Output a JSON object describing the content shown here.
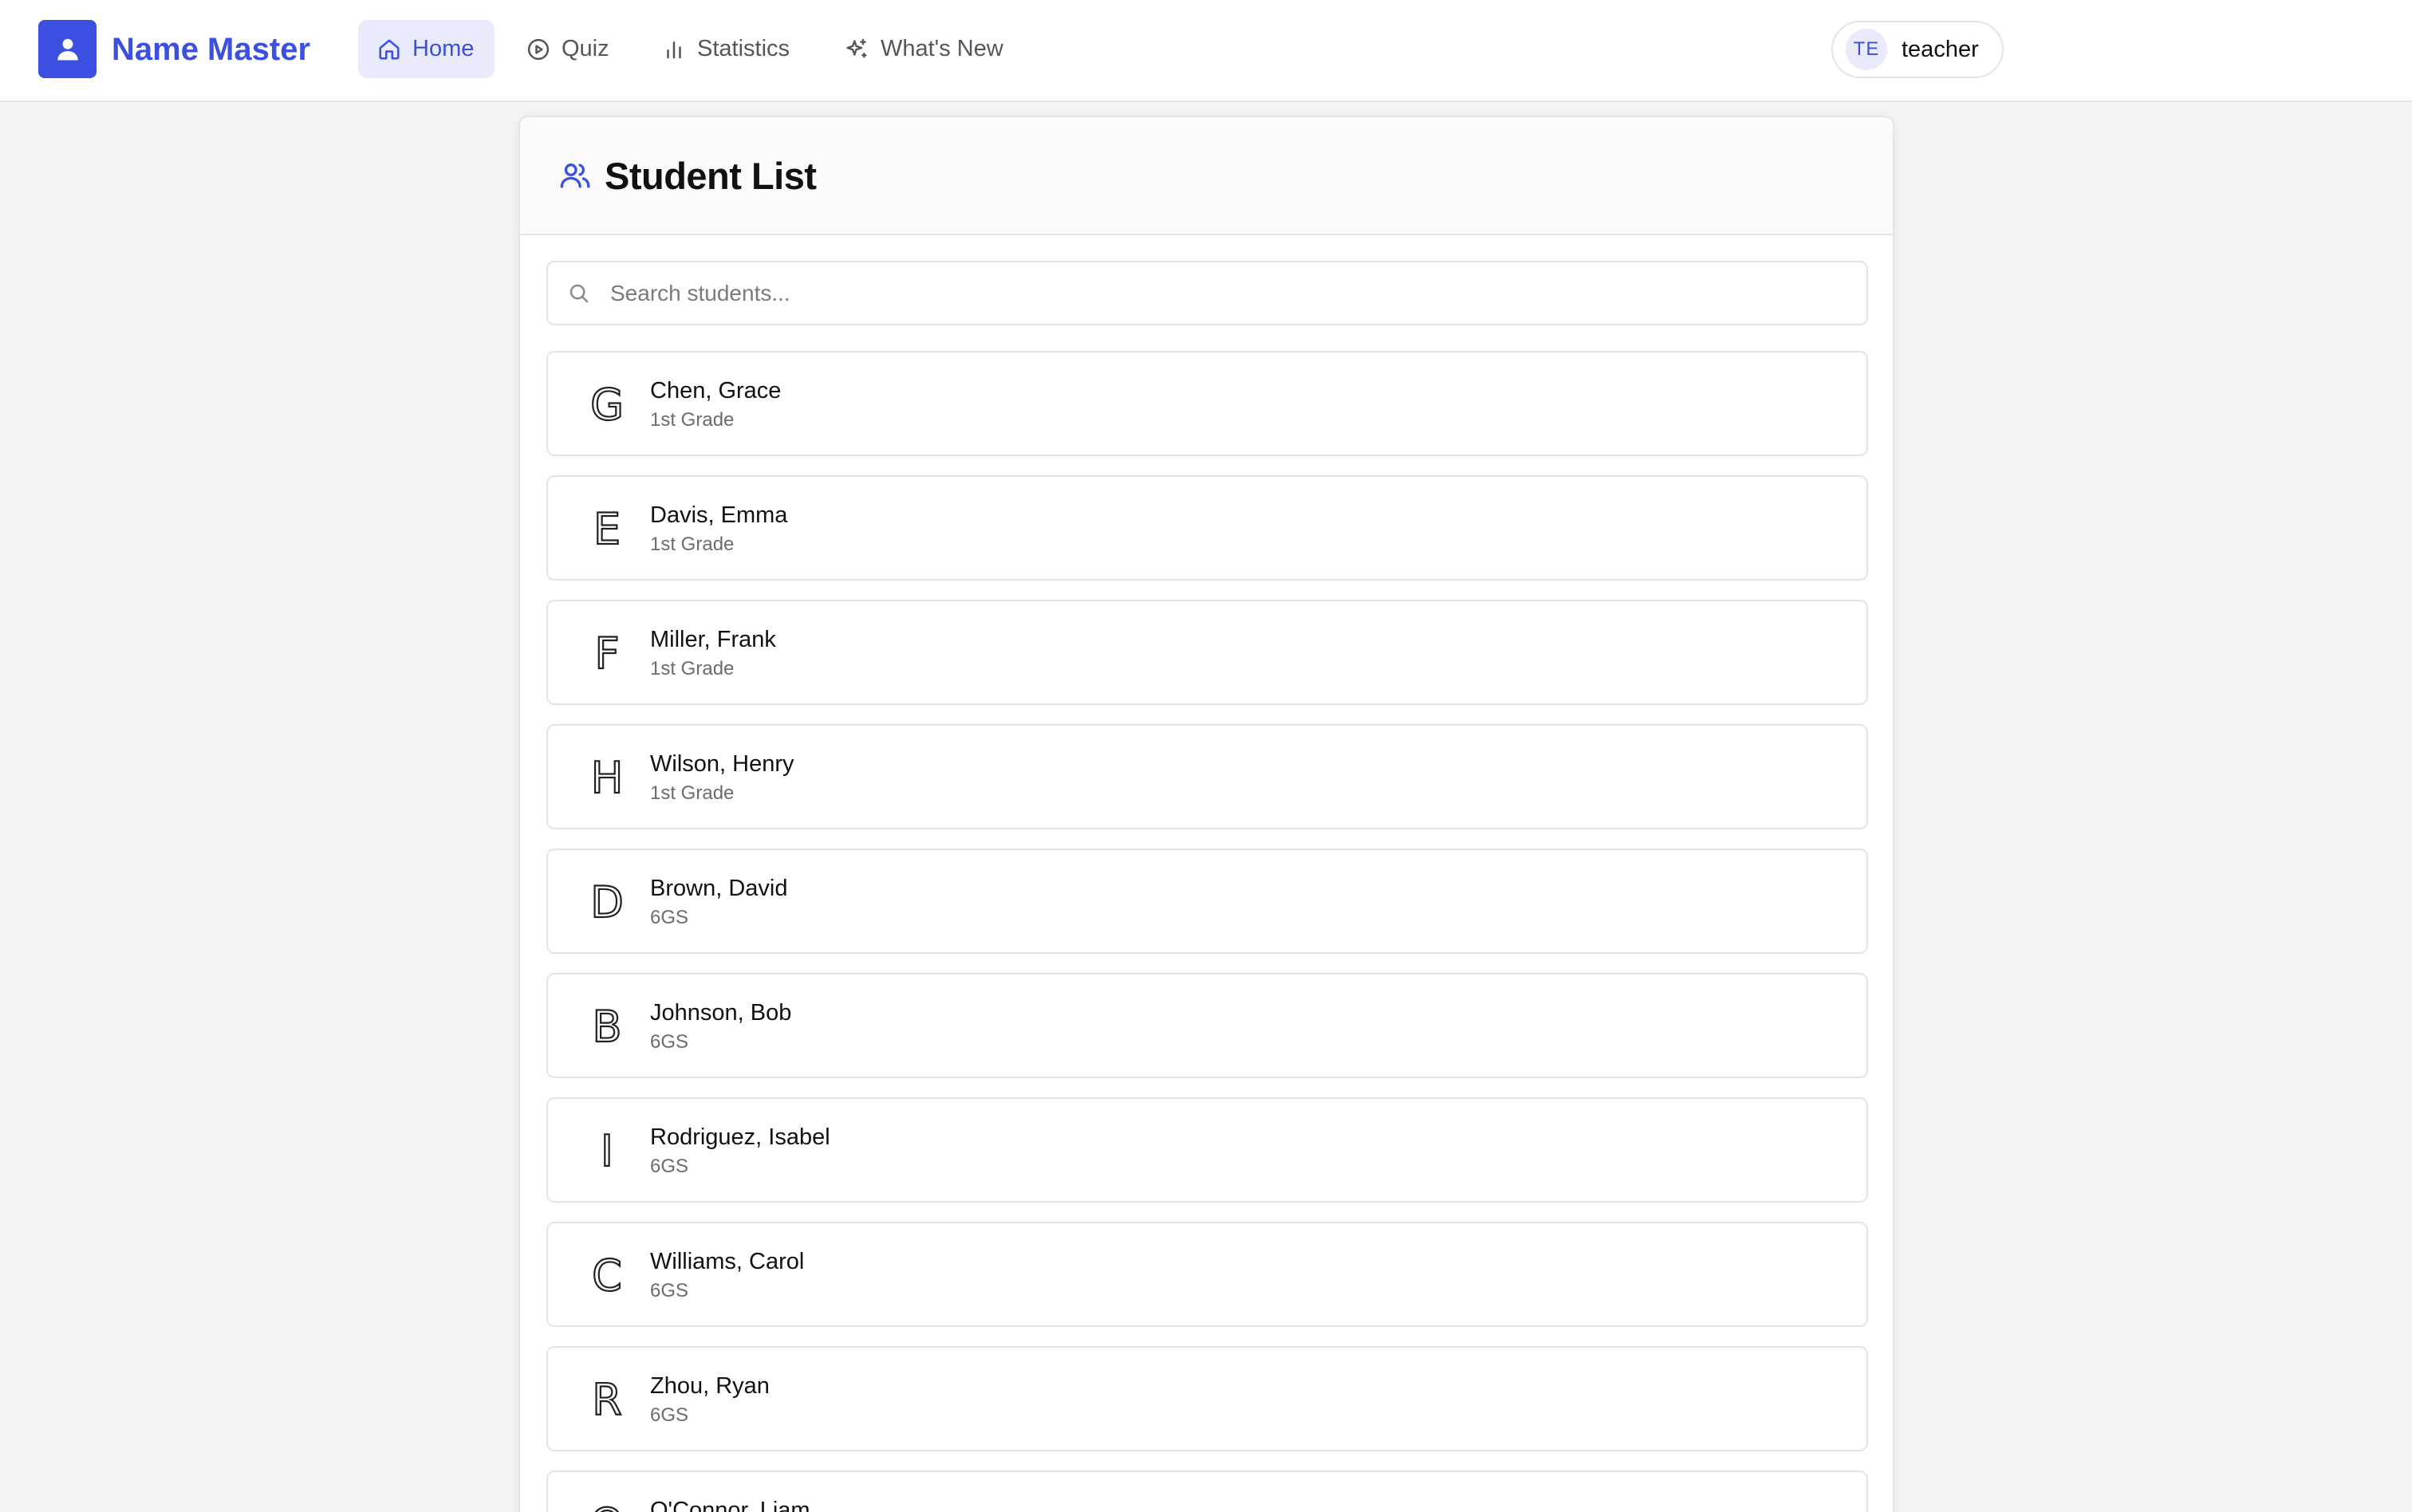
{
  "app": {
    "title": "Name Master",
    "logo_icon": "user-icon",
    "accent": "#3b4fe0"
  },
  "nav": {
    "items": [
      {
        "label": "Home",
        "icon": "home-icon",
        "active": true
      },
      {
        "label": "Quiz",
        "icon": "play-circle-icon"
      },
      {
        "label": "Statistics",
        "icon": "bar-chart-icon"
      },
      {
        "label": "What's New",
        "icon": "sparkles-icon"
      }
    ]
  },
  "user": {
    "initials": "TE",
    "name": "teacher"
  },
  "card": {
    "title": "Student List",
    "icon": "users-icon"
  },
  "search": {
    "placeholder": "Search students...",
    "value": ""
  },
  "students": [
    {
      "letter": "G",
      "name": "Chen, Grace",
      "class": "1st Grade"
    },
    {
      "letter": "E",
      "name": "Davis, Emma",
      "class": "1st Grade"
    },
    {
      "letter": "F",
      "name": "Miller, Frank",
      "class": "1st Grade"
    },
    {
      "letter": "H",
      "name": "Wilson, Henry",
      "class": "1st Grade"
    },
    {
      "letter": "D",
      "name": "Brown, David",
      "class": "6GS"
    },
    {
      "letter": "B",
      "name": "Johnson, Bob",
      "class": "6GS"
    },
    {
      "letter": "I",
      "name": "Rodriguez, Isabel",
      "class": "6GS"
    },
    {
      "letter": "C",
      "name": "Williams, Carol",
      "class": "6GS"
    },
    {
      "letter": "R",
      "name": "Zhou, Ryan",
      "class": "6GS"
    },
    {
      "letter": "O",
      "name": "O'Connor, Liam",
      "class": ""
    }
  ]
}
